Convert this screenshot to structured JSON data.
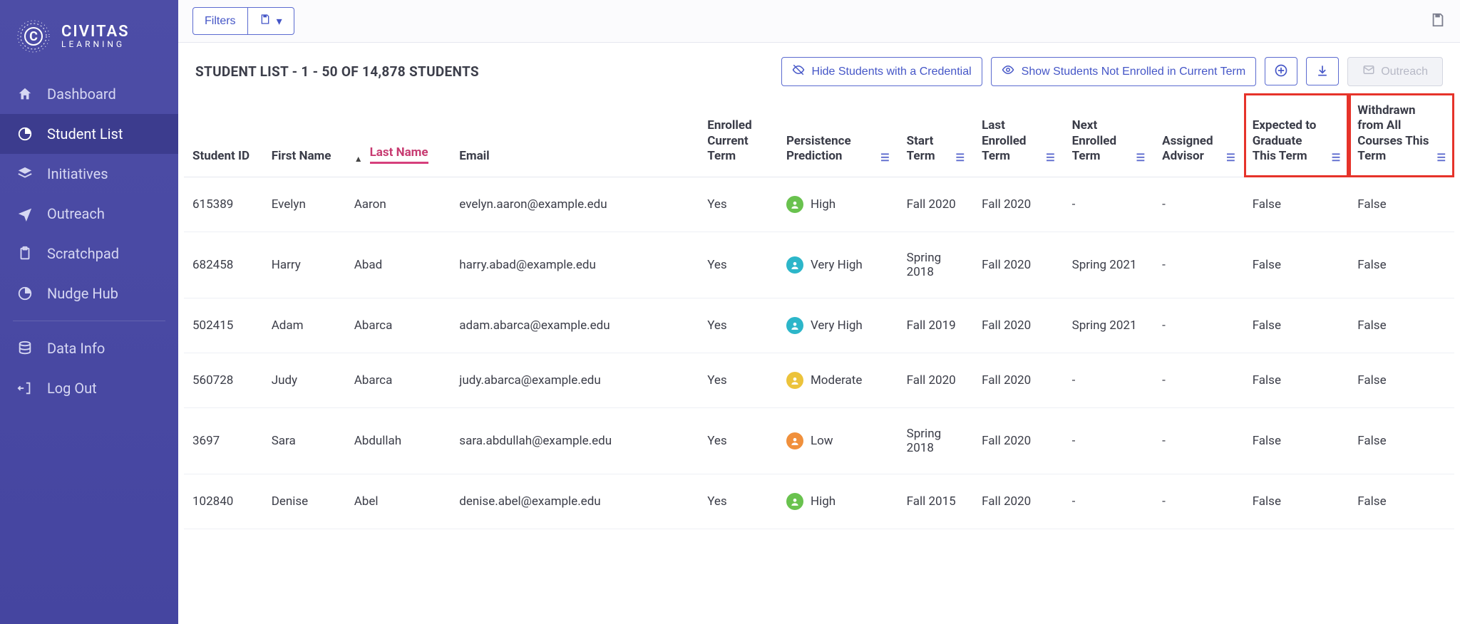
{
  "brand": {
    "line1": "CIVITAS",
    "line2": "LEARNING"
  },
  "nav": {
    "items": [
      {
        "label": "Dashboard",
        "icon": "home"
      },
      {
        "label": "Student List",
        "icon": "pie",
        "active": true
      },
      {
        "label": "Initiatives",
        "icon": "layers"
      },
      {
        "label": "Outreach",
        "icon": "send"
      },
      {
        "label": "Scratchpad",
        "icon": "clipboard"
      },
      {
        "label": "Nudge Hub",
        "icon": "pie"
      }
    ],
    "secondary": [
      {
        "label": "Data Info",
        "icon": "db"
      },
      {
        "label": "Log Out",
        "icon": "logout"
      }
    ]
  },
  "toolbar": {
    "filters": "Filters"
  },
  "listHeader": {
    "title": "STUDENT LIST - 1 - 50 OF 14,878 STUDENTS",
    "hide": "Hide Students with a Credential",
    "show": "Show Students Not Enrolled in Current Term",
    "outreach": "Outreach"
  },
  "columns": {
    "id": "Student ID",
    "first": "First Name",
    "last": "Last Name",
    "email": "Email",
    "ect": "Enrolled Current Term",
    "pp": "Persistence Prediction",
    "start": "Start Term",
    "let": "Last Enrolled Term",
    "net": "Next Enrolled Term",
    "aa": "Assigned Advisor",
    "egt": "Expected to Graduate This Term",
    "wac": "Withdrawn from All Courses This Term"
  },
  "rows": [
    {
      "id": "615389",
      "first": "Evelyn",
      "last": "Aaron",
      "email": "evelyn.aaron@example.edu",
      "ect": "Yes",
      "pp": "High",
      "ppClass": "pp-high",
      "start": "Fall 2020",
      "let": "Fall 2020",
      "net": "-",
      "aa": "-",
      "egt": "False",
      "wac": "False"
    },
    {
      "id": "682458",
      "first": "Harry",
      "last": "Abad",
      "email": "harry.abad@example.edu",
      "ect": "Yes",
      "pp": "Very High",
      "ppClass": "pp-veryhigh",
      "start": "Spring 2018",
      "let": "Fall 2020",
      "net": "Spring 2021",
      "aa": "-",
      "egt": "False",
      "wac": "False"
    },
    {
      "id": "502415",
      "first": "Adam",
      "last": "Abarca",
      "email": "adam.abarca@example.edu",
      "ect": "Yes",
      "pp": "Very High",
      "ppClass": "pp-veryhigh",
      "start": "Fall 2019",
      "let": "Fall 2020",
      "net": "Spring 2021",
      "aa": "-",
      "egt": "False",
      "wac": "False"
    },
    {
      "id": "560728",
      "first": "Judy",
      "last": "Abarca",
      "email": "judy.abarca@example.edu",
      "ect": "Yes",
      "pp": "Moderate",
      "ppClass": "pp-moderate",
      "start": "Fall 2020",
      "let": "Fall 2020",
      "net": "-",
      "aa": "-",
      "egt": "False",
      "wac": "False"
    },
    {
      "id": "3697",
      "first": "Sara",
      "last": "Abdullah",
      "email": "sara.abdullah@example.edu",
      "ect": "Yes",
      "pp": "Low",
      "ppClass": "pp-low",
      "start": "Spring 2018",
      "let": "Fall 2020",
      "net": "-",
      "aa": "-",
      "egt": "False",
      "wac": "False"
    },
    {
      "id": "102840",
      "first": "Denise",
      "last": "Abel",
      "email": "denise.abel@example.edu",
      "ect": "Yes",
      "pp": "High",
      "ppClass": "pp-high",
      "start": "Fall 2015",
      "let": "Fall 2020",
      "net": "-",
      "aa": "-",
      "egt": "False",
      "wac": "False"
    }
  ]
}
